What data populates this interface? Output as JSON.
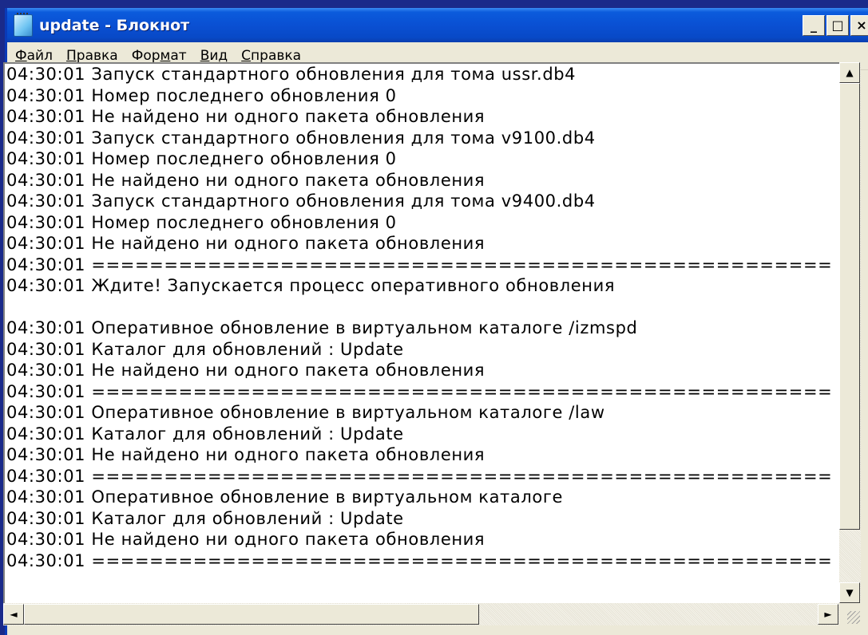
{
  "window": {
    "title": "update - Блокнот"
  },
  "title_buttons": {
    "minimize": "_",
    "maximize": "□",
    "close": "×"
  },
  "menu": {
    "items": [
      {
        "accel": "Ф",
        "rest": "айл"
      },
      {
        "accel": "П",
        "rest": "равка"
      },
      {
        "pre": "Фор",
        "accel": "м",
        "rest": "ат"
      },
      {
        "accel": "В",
        "rest": "ид"
      },
      {
        "accel": "С",
        "rest": "правка"
      }
    ]
  },
  "document": {
    "lines": [
      "04:30:01 Запуск стандартного обновления для тома ussr.db4",
      "04:30:01 Номер последнего обновления 0",
      "04:30:01 Не найдено ни одного пакета обновления",
      "04:30:01 Запуск стандартного обновления для тома v9100.db4",
      "04:30:01 Номер последнего обновления 0",
      "04:30:01 Не найдено ни одного пакета обновления",
      "04:30:01 Запуск стандартного обновления для тома v9400.db4",
      "04:30:01 Номер последнего обновления 0",
      "04:30:01 Не найдено ни одного пакета обновления",
      "04:30:01 ===================================================",
      "04:30:01 Ждите! Запускается процесс оперативного обновления",
      "",
      "04:30:01 Оперативное обновление в виртуальном каталоге /izmspd",
      "04:30:01 Каталог для обновлений : Update",
      "04:30:01 Не найдено ни одного пакета обновления",
      "04:30:01 ===================================================",
      "04:30:01 Оперативное обновление в виртуальном каталоге /law",
      "04:30:01 Каталог для обновлений : Update",
      "04:30:01 Не найдено ни одного пакета обновления",
      "04:30:01 ===================================================",
      "04:30:01 Оперативное обновление в виртуальном каталоге",
      "04:30:01 Каталог для обновлений : Update",
      "04:30:01 Не найдено ни одного пакета обновления",
      "04:30:01 ==================================================="
    ]
  },
  "scrollbars": {
    "up_arrow": "▲",
    "down_arrow": "▼",
    "left_arrow": "◄",
    "right_arrow": "►"
  }
}
